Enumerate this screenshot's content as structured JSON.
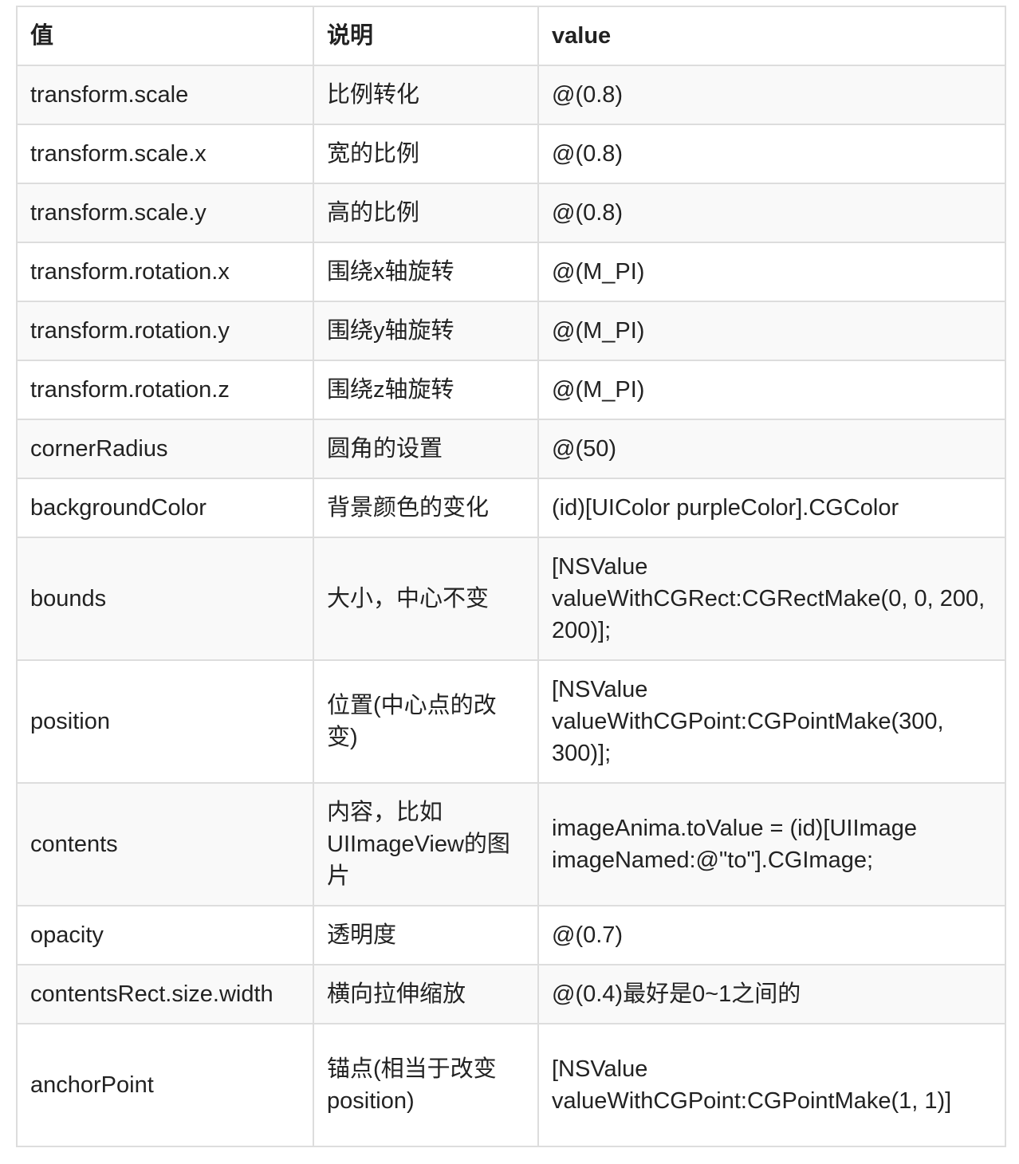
{
  "table": {
    "headers": [
      "值",
      "说明",
      "value"
    ],
    "rows": [
      {
        "key": "transform.scale",
        "desc": "比例转化",
        "value": "@(0.8)"
      },
      {
        "key": "transform.scale.x",
        "desc": "宽的比例",
        "value": "@(0.8)"
      },
      {
        "key": "transform.scale.y",
        "desc": "高的比例",
        "value": "@(0.8)"
      },
      {
        "key": "transform.rotation.x",
        "desc": "围绕x轴旋转",
        "value": "@(M_PI)"
      },
      {
        "key": "transform.rotation.y",
        "desc": "围绕y轴旋转",
        "value": "@(M_PI)"
      },
      {
        "key": "transform.rotation.z",
        "desc": "围绕z轴旋转",
        "value": "@(M_PI)"
      },
      {
        "key": "cornerRadius",
        "desc": "圆角的设置",
        "value": "@(50)"
      },
      {
        "key": "backgroundColor",
        "desc": "背景颜色的变化",
        "value": "(id)[UIColor purpleColor].CGColor"
      },
      {
        "key": "bounds",
        "desc": "大小，中心不变",
        "value": "[NSValue valueWithCGRect:CGRectMake(0, 0, 200, 200)];"
      },
      {
        "key": "position",
        "desc": "位置(中心点的改变)",
        "value": "[NSValue valueWithCGPoint:CGPointMake(300, 300)];"
      },
      {
        "key": "contents",
        "desc": "内容，比如UIImageView的图片",
        "value": "imageAnima.toValue = (id)[UIImage imageNamed:@\"to\"].CGImage;"
      },
      {
        "key": "opacity",
        "desc": "透明度",
        "value": "@(0.7)"
      },
      {
        "key": "contentsRect.size.width",
        "desc": "横向拉伸缩放",
        "value": "@(0.4)最好是0~1之间的"
      },
      {
        "key": "anchorPoint",
        "desc": "锚点(相当于改变position)",
        "value": "[NSValue valueWithCGPoint:CGPointMake(1, 1)]"
      }
    ]
  }
}
